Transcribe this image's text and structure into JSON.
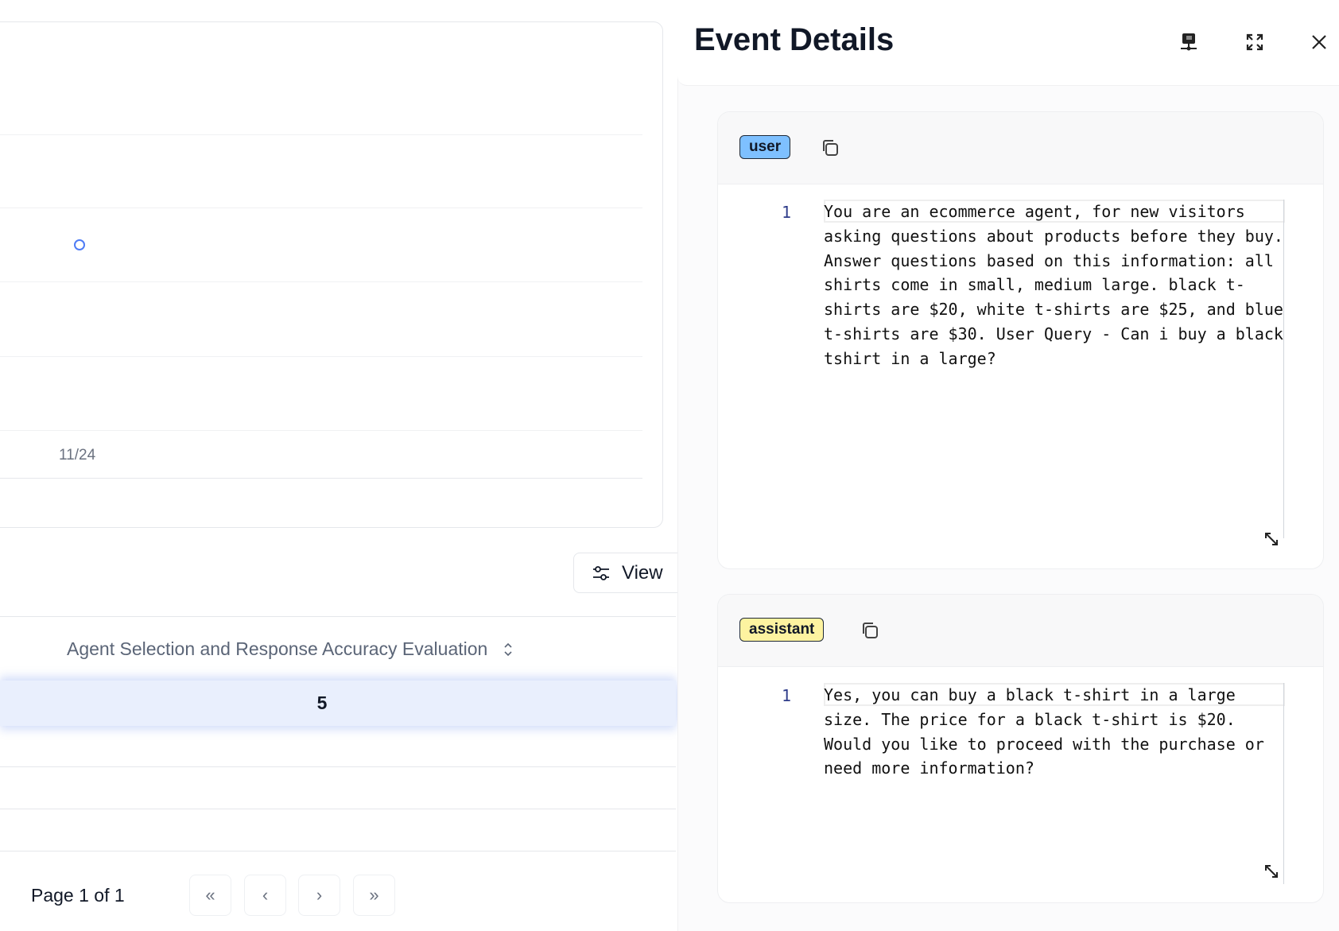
{
  "chart": {
    "x_tick": "11/24",
    "point_color": "#4f7cf5"
  },
  "toolbar": {
    "view_label": "View"
  },
  "table": {
    "column_header": "Agent Selection and Response Accuracy Evaluation",
    "selected_row_value": "5"
  },
  "pagination": {
    "label": "Page 1 of 1",
    "first": "«",
    "prev": "‹",
    "next": "›",
    "last": "»"
  },
  "panel": {
    "title": "Event Details",
    "messages": [
      {
        "role": "user",
        "badge_color": "#7ec0ff",
        "line_number": "1",
        "content": "You are an ecommerce agent, for new visitors asking questions about products before they buy. Answer questions based on this information: all shirts come in small, medium large. black t-shirts are $20, white t-shirts are $25, and blue t-shirts are $30. User Query - Can i buy a black tshirt in a large?"
      },
      {
        "role": "assistant",
        "badge_color": "#fdf3a0",
        "line_number": "1",
        "content": "Yes, you can buy a black t-shirt in a large size. The price for a black t-shirt is $20. Would you like to proceed with the purchase or need more information?"
      }
    ]
  }
}
